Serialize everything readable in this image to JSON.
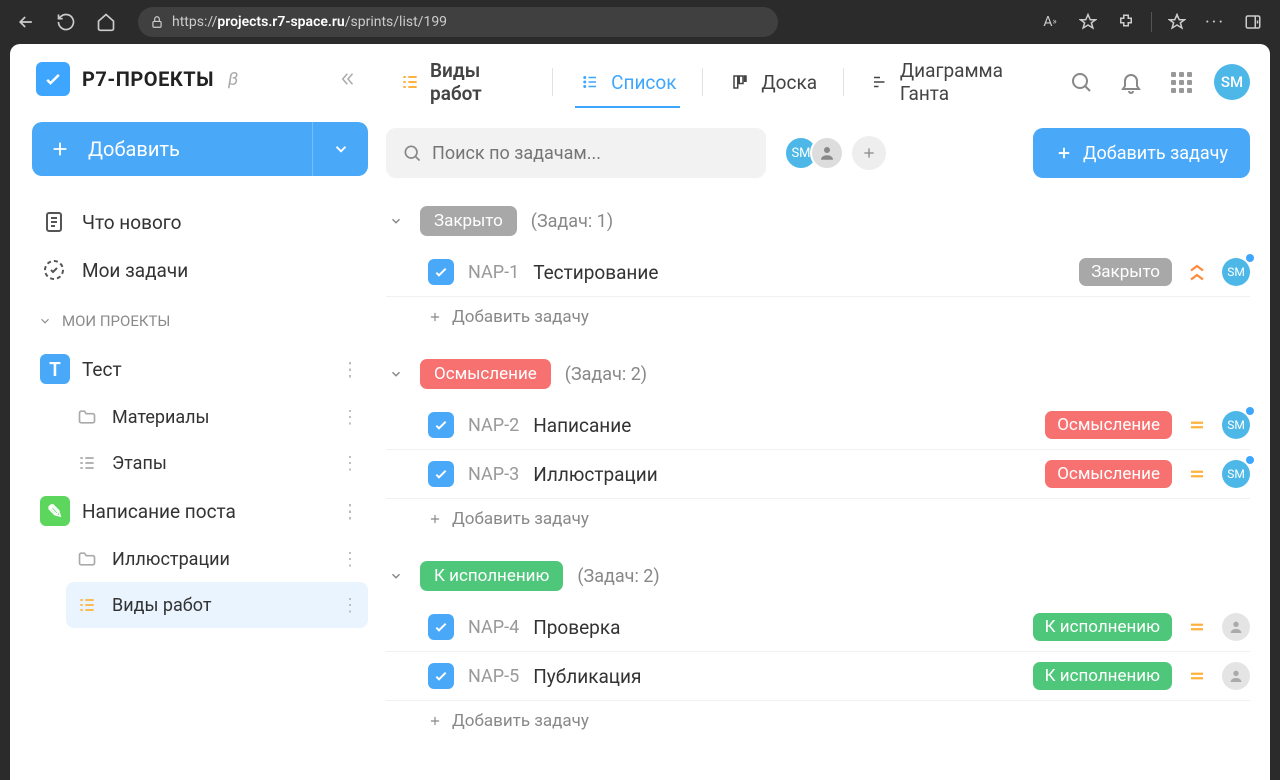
{
  "browser": {
    "url_domain": "projects.r7-space.ru",
    "url_prefix": "https://",
    "url_path": "/sprints/list/199"
  },
  "app": {
    "logo": "Р7-ПРОЕКТЫ",
    "beta": "β",
    "addButton": "Добавить",
    "nav": {
      "whatsnew": "Что нового",
      "mytasks": "Мои задачи"
    },
    "projectsHeader": "МОИ ПРОЕКТЫ",
    "projects": [
      {
        "name": "Тест",
        "iconLetter": "Т",
        "iconBg": "#49a8f8",
        "children": [
          {
            "name": "Материалы",
            "icon": "folder"
          },
          {
            "name": "Этапы",
            "icon": "list"
          }
        ]
      },
      {
        "name": "Написание поста",
        "iconLetter": "✎",
        "iconBg": "#5cd65c",
        "children": [
          {
            "name": "Иллюстрации",
            "icon": "folder"
          },
          {
            "name": "Виды работ",
            "icon": "list",
            "active": true
          }
        ]
      }
    ]
  },
  "views": {
    "title": "Виды работ",
    "tabs": {
      "list": "Список",
      "board": "Доска",
      "gantt": "Диаграмма Ганта"
    }
  },
  "toolbar": {
    "searchPlaceholder": "Поиск по задачам...",
    "addTask": "Добавить задачу",
    "userInitials": "SM"
  },
  "groups": [
    {
      "status": "Закрыто",
      "cls": "gray",
      "countLabel": "(Задач: 1)",
      "tasks": [
        {
          "key": "NAP-1",
          "title": "Тестирование",
          "status": "Закрыто",
          "statusCls": "gray",
          "prio": "high",
          "assignee": "SM"
        }
      ]
    },
    {
      "status": "Осмысление",
      "cls": "red",
      "countLabel": "(Задач: 2)",
      "tasks": [
        {
          "key": "NAP-2",
          "title": "Написание",
          "status": "Осмысление",
          "statusCls": "red",
          "prio": "eq",
          "assignee": "SM"
        },
        {
          "key": "NAP-3",
          "title": "Иллюстрации",
          "status": "Осмысление",
          "statusCls": "red",
          "prio": "eq",
          "assignee": "SM"
        }
      ]
    },
    {
      "status": "К исполнению",
      "cls": "green",
      "countLabel": "(Задач: 2)",
      "tasks": [
        {
          "key": "NAP-4",
          "title": "Проверка",
          "status": "К исполнению",
          "statusCls": "green",
          "prio": "eq",
          "assignee": ""
        },
        {
          "key": "NAP-5",
          "title": "Публикация",
          "status": "К исполнению",
          "statusCls": "green",
          "prio": "eq",
          "assignee": ""
        }
      ]
    }
  ],
  "addTaskInline": "Добавить задачу"
}
